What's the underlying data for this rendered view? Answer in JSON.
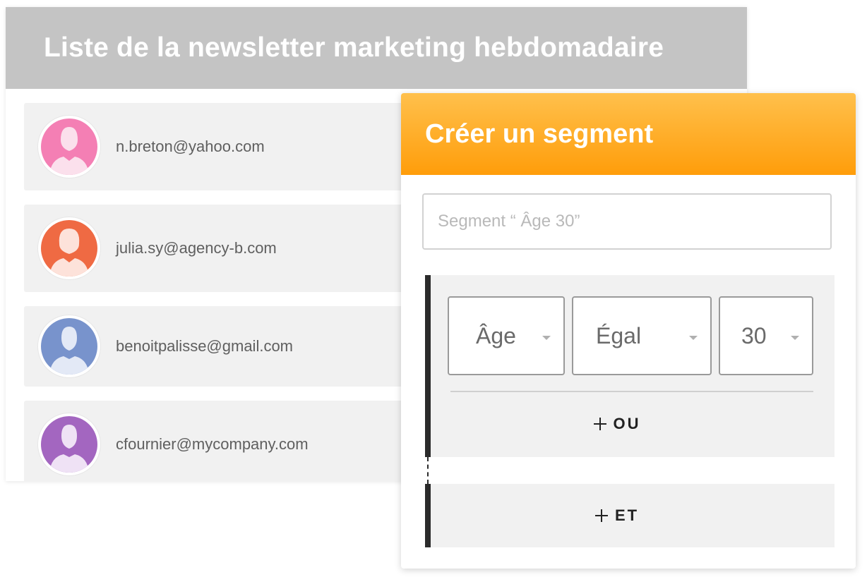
{
  "newsletter_list": {
    "title": "Liste de la newsletter marketing hebdomadaire",
    "contacts": [
      {
        "email": "n.breton@yahoo.com",
        "avatar_icon": "female-user-icon",
        "avatar_color": "#f47fb4",
        "figure_color": "#fbe0ec"
      },
      {
        "email": "julia.sy@agency-b.com",
        "avatar_icon": "female-user-icon",
        "avatar_color": "#ef6a43",
        "figure_color": "#fde2da"
      },
      {
        "email": "benoitpalisse@gmail.com",
        "avatar_icon": "male-user-icon",
        "avatar_color": "#7893cc",
        "figure_color": "#e3e9f6"
      },
      {
        "email": "cfournier@mycompany.com",
        "avatar_icon": "male-user-icon",
        "avatar_color": "#a366c0",
        "figure_color": "#efe2f5"
      }
    ]
  },
  "segment": {
    "title": "Créer un segment",
    "name_placeholder": "Segment “ Âge 30”",
    "rule": {
      "field": "Âge",
      "operator": "Égal",
      "value": "30"
    },
    "or_label": "OU",
    "and_label": "ET"
  },
  "colors": {
    "list_header": "#c4c4c4",
    "segment_header_top": "#ffc04c",
    "segment_header_bottom": "#ff9d0a"
  }
}
